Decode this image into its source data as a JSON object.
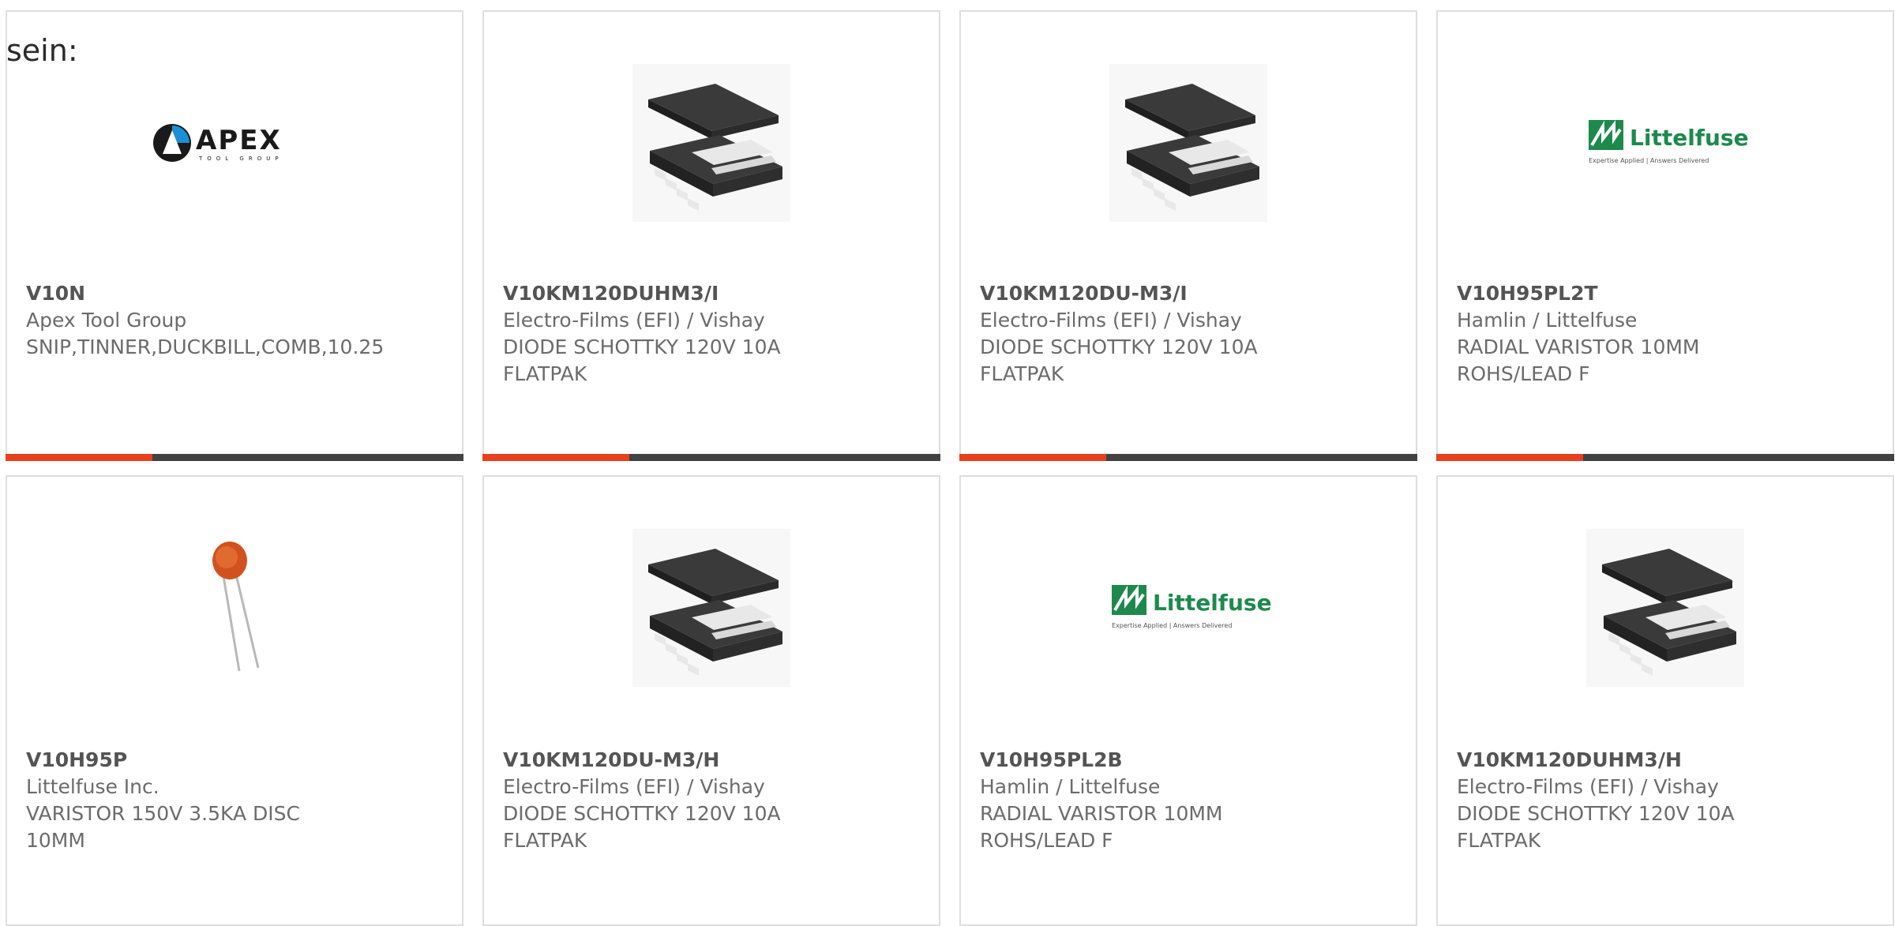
{
  "intro_text": "sein:",
  "accent_color": "#e8401c",
  "bar_color": "#424242",
  "products": [
    {
      "part": "V10N",
      "maker": "Apex Tool Group",
      "desc": "SNIP,TINNER,DUCKBILL,COMB,10.25",
      "image": "apex-tool-group-logo",
      "logo_text": "APEX",
      "logo_sub": "TOOL GROUP",
      "active": true
    },
    {
      "part": "V10KM120DUHM3/I",
      "maker": "Electro-Films (EFI) / Vishay",
      "desc": "DIODE SCHOTTKY 120V 10A\nFLATPAK",
      "image": "flatpak-chip-image",
      "active": true
    },
    {
      "part": "V10KM120DU-M3/I",
      "maker": "Electro-Films (EFI) / Vishay",
      "desc": "DIODE SCHOTTKY 120V 10A\nFLATPAK",
      "image": "flatpak-chip-image",
      "active": true
    },
    {
      "part": "V10H95PL2T",
      "maker": "Hamlin / Littelfuse",
      "desc": "RADIAL VARISTOR 10MM\nROHS/LEAD F",
      "image": "littelfuse-logo",
      "logo_text": "Littelfuse",
      "logo_sub": "Expertise Applied | Answers Delivered",
      "active": true
    },
    {
      "part": "V10H95P",
      "maker": "Littelfuse Inc.",
      "desc": "VARISTOR 150V 3.5KA DISC\n10MM",
      "image": "disc-varistor-image",
      "active": false
    },
    {
      "part": "V10KM120DU-M3/H",
      "maker": "Electro-Films (EFI) / Vishay",
      "desc": "DIODE SCHOTTKY 120V 10A\nFLATPAK",
      "image": "flatpak-chip-image",
      "active": false
    },
    {
      "part": "V10H95PL2B",
      "maker": "Hamlin / Littelfuse",
      "desc": "RADIAL VARISTOR 10MM\nROHS/LEAD F",
      "image": "littelfuse-logo",
      "logo_text": "Littelfuse",
      "logo_sub": "Expertise Applied | Answers Delivered",
      "active": false
    },
    {
      "part": "V10KM120DUHM3/H",
      "maker": "Electro-Films (EFI) / Vishay",
      "desc": "DIODE SCHOTTKY 120V 10A\nFLATPAK",
      "image": "flatpak-chip-image",
      "active": false
    }
  ]
}
